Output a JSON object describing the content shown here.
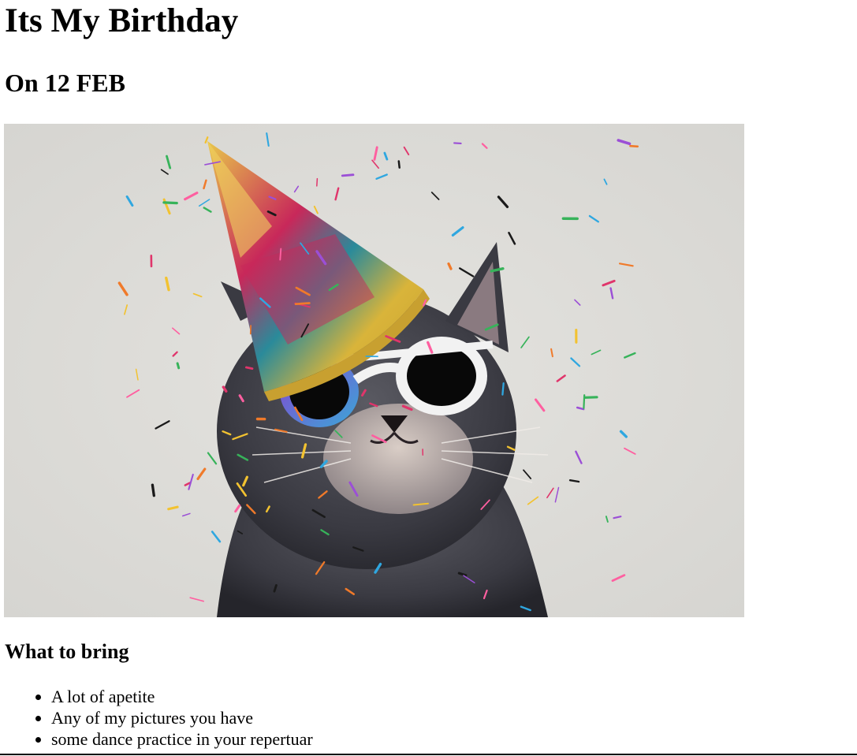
{
  "page": {
    "title": "Its My Birthday",
    "subtitle": "On 12 FEB"
  },
  "photo": {
    "subject": "cat-in-party-hat-and-sunglasses",
    "colors": {
      "background": "#dcdbd7",
      "fur": "#3b3b40",
      "hat_gold": "#d9b43a",
      "hat_pink": "#c8285a",
      "hat_teal": "#2a8a9a",
      "glasses_frame": "#f2f2f2",
      "lens": "#0a0a0a"
    }
  },
  "bring": {
    "heading": "What to bring",
    "items": [
      "A lot of apetite",
      "Any of my pictures you have",
      "some dance practice in your repertuar"
    ]
  }
}
